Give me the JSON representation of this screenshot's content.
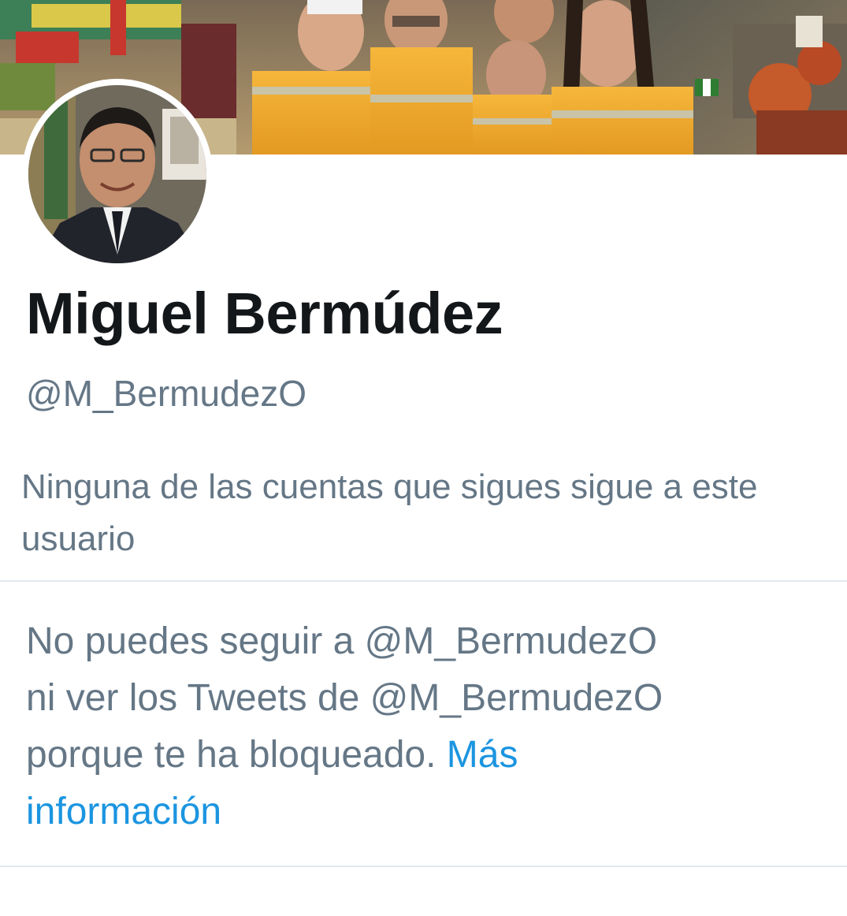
{
  "profile": {
    "display_name": "Miguel Bermúdez",
    "handle": "@M_BermudezO",
    "followers_note": "Ninguna de las cuentas que sigues sigue a este usuario",
    "banner_icon": "group-photo-image",
    "avatar_icon": "profile-photo-image"
  },
  "blocked_notice": {
    "line1": "No puedes seguir a @M_BermudezO",
    "line2": "ni ver los Tweets de @M_BermudezO",
    "line3": "porque te ha bloqueado.",
    "link_part1": "Más",
    "link_part2": "información"
  },
  "colors": {
    "primary_text": "#14171a",
    "secondary_text": "#657786",
    "link": "#1b95e0",
    "divider": "#e1e8ed",
    "vest_orange": "#f0a830"
  }
}
